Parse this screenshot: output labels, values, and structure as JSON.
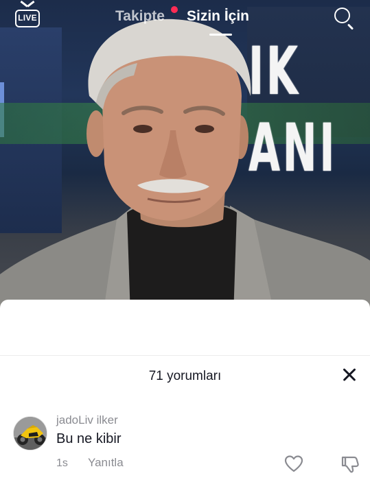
{
  "header": {
    "live_label": "LIVE",
    "tabs": [
      {
        "label": "Takipte",
        "active": false,
        "has_notification_dot": true
      },
      {
        "label": "Sizin İçin",
        "active": true
      }
    ],
    "icons": {
      "live": "live-tv-icon",
      "search": "search-icon"
    }
  },
  "video": {
    "background_text": "IK ANI"
  },
  "comments": {
    "count_label": "71 yorumları",
    "close_icon": "close-icon",
    "items": [
      {
        "username": "jadoLiv ilker",
        "text": "Bu ne kibir",
        "time": "1s",
        "reply_label": "Yanıtla",
        "avatar": "motorcycle-avatar",
        "like_icon": "heart-outline-icon",
        "dislike_icon": "thumbs-down-icon"
      }
    ]
  },
  "colors": {
    "accent": "#fe2c55",
    "text_primary": "#161823",
    "text_secondary": "#8a8b91",
    "sheet_background": "#ffffff"
  }
}
